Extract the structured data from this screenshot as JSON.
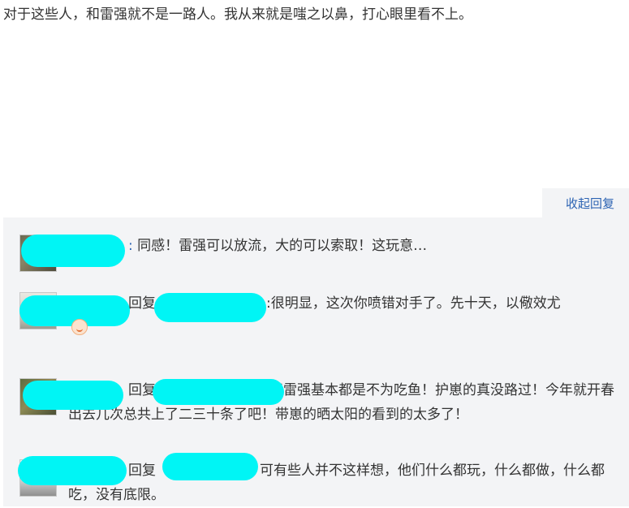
{
  "post": {
    "text": "对于这些人，和雷强就不是一路人。我从来就是嗤之以鼻，打心眼里看不上。"
  },
  "reply_panel": {
    "collapse_label": "收起回复"
  },
  "replies": [
    {
      "prefix": ":",
      "text": "同感！雷强可以放流，大的可以索取！这玩意…"
    },
    {
      "reply_word": "回复",
      "text": ":很明显，这次你喷错对手了。先十天，以儆效尤",
      "emoji": "smile-emoji"
    },
    {
      "reply_word": "回复",
      "text": "玩雷强基本都是不为吃鱼！护崽的真没路过！今年就开春出去几次总共上了二三十条了吧！带崽的晒太阳的看到的太多了！"
    },
    {
      "reply_word": "回复",
      "text": "可有些人并不这样想，他们什么都玩，什么都做，什么都吃，没有底限。"
    }
  ],
  "colors": {
    "link": "#2d64b3",
    "panel_bg": "#f3f4f6",
    "redaction": "#00f5f5"
  }
}
